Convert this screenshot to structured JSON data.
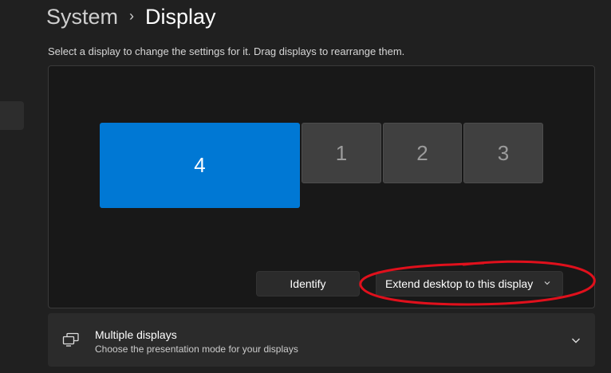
{
  "breadcrumb": {
    "parent": "System",
    "separator": "›",
    "current": "Display"
  },
  "instruction": "Select a display to change the settings for it. Drag displays to rearrange them.",
  "monitors": [
    {
      "label": "4",
      "state": "selected"
    },
    {
      "label": "1",
      "state": "unselected"
    },
    {
      "label": "2",
      "state": "unselected"
    },
    {
      "label": "3",
      "state": "unselected"
    }
  ],
  "controls": {
    "identify_label": "Identify",
    "extend_mode": {
      "selected": "Extend desktop to this display",
      "icon": "chevron-down-icon"
    }
  },
  "multiple_displays": {
    "title": "Multiple displays",
    "subtitle": "Choose the presentation mode for your displays",
    "icon": "multiple-displays-icon",
    "chevron_icon": "chevron-down-icon"
  },
  "colors": {
    "accent": "#0078d4",
    "annotation": "#e0101c",
    "background": "#202020"
  }
}
